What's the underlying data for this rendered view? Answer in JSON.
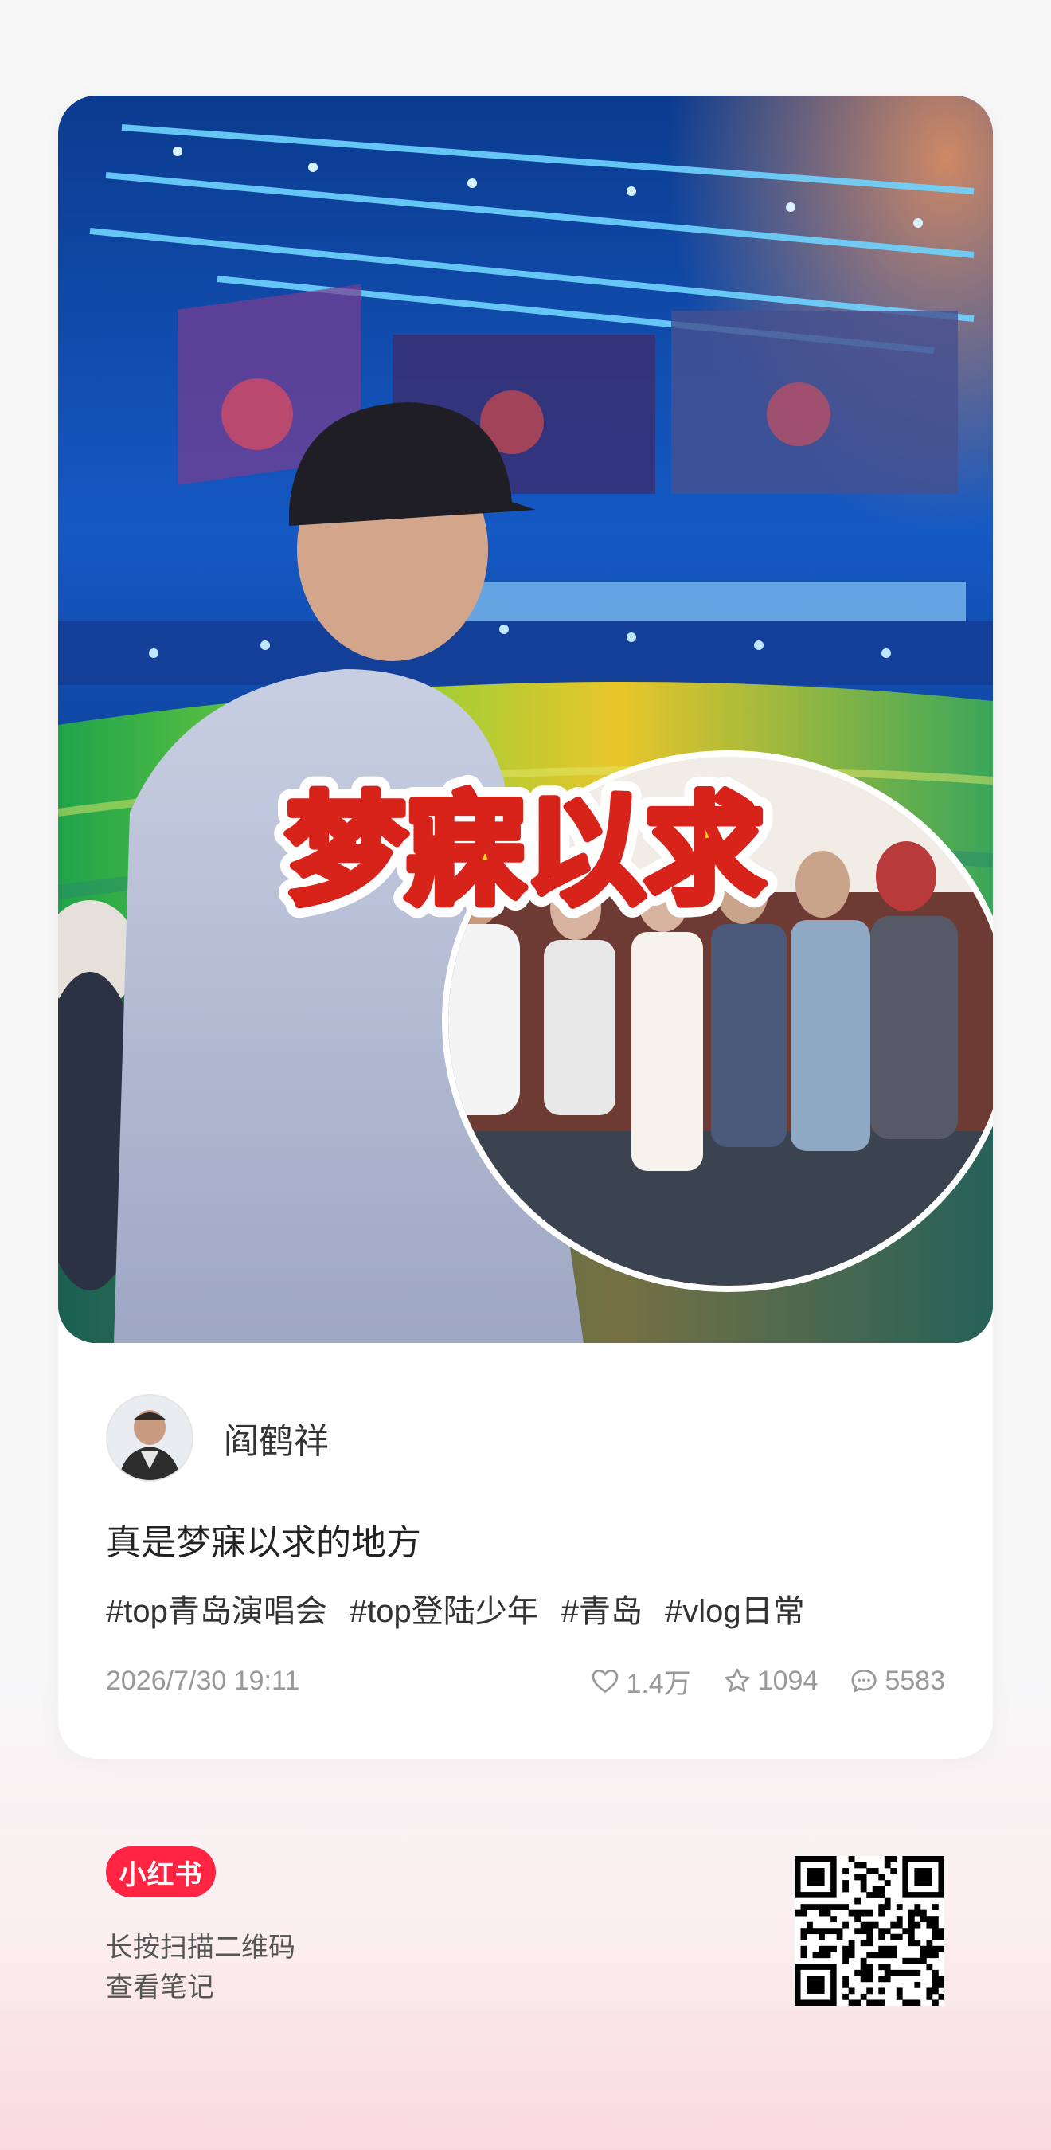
{
  "cover": {
    "overlay_text": "梦寐以求"
  },
  "author": {
    "name": "阎鹤祥"
  },
  "note": {
    "title": "真是梦寐以求的地方",
    "tags": [
      "#top青岛演唱会",
      "#top登陆少年",
      "#青岛",
      "#vlog日常"
    ],
    "date": "2026/7/30 19:11",
    "likes": "1.4万",
    "favorites": "1094",
    "comments": "5583"
  },
  "footer": {
    "logo": "小红书",
    "hint_line1": "长按扫描二维码",
    "hint_line2": "查看笔记"
  },
  "colors": {
    "brand": "#ff2442",
    "overlay_text_fill": "#ffd21a",
    "overlay_text_stroke": "#d8231a"
  }
}
